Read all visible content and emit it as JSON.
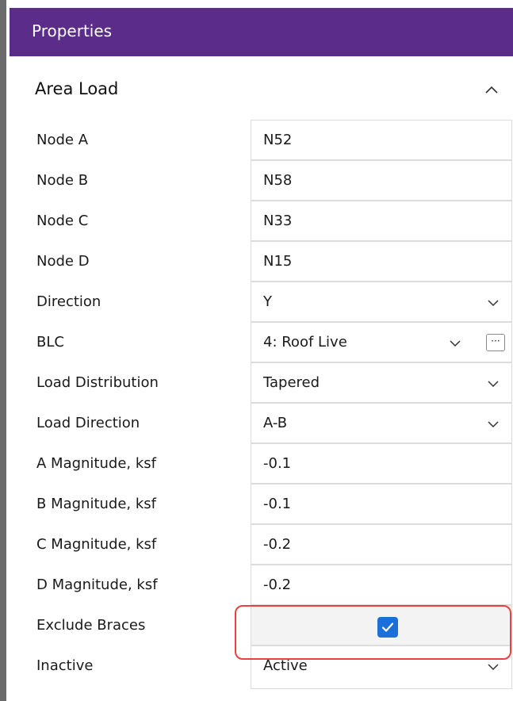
{
  "panel": {
    "title": "Properties"
  },
  "section": {
    "title": "Area Load",
    "collapse_icon": "chevron-up-icon"
  },
  "properties": [
    {
      "label": "Node A",
      "value": "N52"
    },
    {
      "label": "Node B",
      "value": "N58"
    },
    {
      "label": "Node C",
      "value": "N33"
    },
    {
      "label": "Node D",
      "value": "N15"
    },
    {
      "label": "Direction",
      "value": "Y",
      "dropdown": true
    },
    {
      "label": "BLC",
      "value": "4: Roof Live",
      "dropdown": true,
      "ellipsis_label": "···"
    },
    {
      "label": "Load Distribution",
      "value": "Tapered",
      "dropdown": true
    },
    {
      "label": "Load Direction",
      "value": "A-B",
      "dropdown": true
    },
    {
      "label": "A Magnitude, ksf",
      "value": "-0.1"
    },
    {
      "label": "B Magnitude, ksf",
      "value": "-0.1"
    },
    {
      "label": "C Magnitude, ksf",
      "value": "-0.2"
    },
    {
      "label": "D Magnitude, ksf",
      "value": "-0.2"
    },
    {
      "label": "Exclude Braces",
      "checked": true
    },
    {
      "label": "Inactive",
      "value": "Active",
      "dropdown": true
    }
  ],
  "colors": {
    "header_bg": "#5b2c8a",
    "checkbox_bg": "#1b6fd8",
    "highlight_border": "#e8413f"
  }
}
